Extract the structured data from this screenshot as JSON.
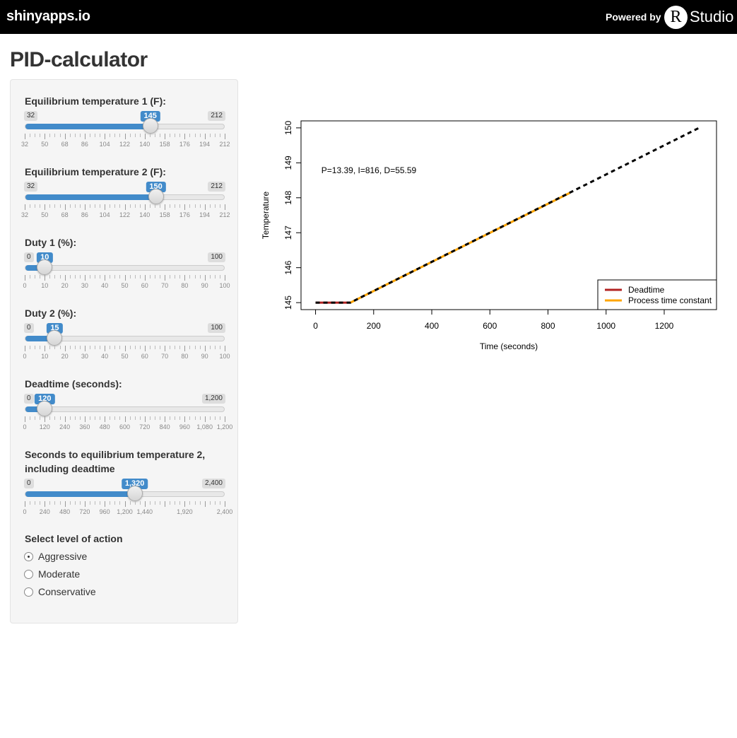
{
  "header": {
    "brand": "shinyapps.io",
    "powered_by": "Powered by",
    "rstudio_r": "R",
    "rstudio_text": "Studio"
  },
  "page": {
    "title": "PID-calculator"
  },
  "controls": {
    "sliders": [
      {
        "id": "temp1",
        "label": "Equilibrium temperature 1 (F):",
        "min": 32,
        "max": 212,
        "value": 145,
        "min_label": "32",
        "max_label": "212",
        "value_label": "145",
        "tick_labels": [
          "32",
          "50",
          "68",
          "86",
          "104",
          "122",
          "140",
          "158",
          "176",
          "194",
          "212"
        ]
      },
      {
        "id": "temp2",
        "label": "Equilibrium temperature 2 (F):",
        "min": 32,
        "max": 212,
        "value": 150,
        "min_label": "32",
        "max_label": "212",
        "value_label": "150",
        "tick_labels": [
          "32",
          "50",
          "68",
          "86",
          "104",
          "122",
          "140",
          "158",
          "176",
          "194",
          "212"
        ]
      },
      {
        "id": "duty1",
        "label": "Duty 1 (%):",
        "min": 0,
        "max": 100,
        "value": 10,
        "min_label": "0",
        "max_label": "100",
        "value_label": "10",
        "tick_labels": [
          "0",
          "10",
          "20",
          "30",
          "40",
          "50",
          "60",
          "70",
          "80",
          "90",
          "100"
        ]
      },
      {
        "id": "duty2",
        "label": "Duty 2 (%):",
        "min": 0,
        "max": 100,
        "value": 15,
        "min_label": "0",
        "max_label": "100",
        "value_label": "15",
        "tick_labels": [
          "0",
          "10",
          "20",
          "30",
          "40",
          "50",
          "60",
          "70",
          "80",
          "90",
          "100"
        ]
      },
      {
        "id": "deadtime",
        "label": "Deadtime (seconds):",
        "min": 0,
        "max": 1200,
        "value": 120,
        "min_label": "0",
        "max_label": "1,200",
        "value_label": "120",
        "tick_labels": [
          "0",
          "120",
          "240",
          "360",
          "480",
          "600",
          "720",
          "840",
          "960",
          "1,080",
          "1,200"
        ]
      },
      {
        "id": "seconds",
        "label": "Seconds to equilibrium temperature 2, including deadtime",
        "min": 0,
        "max": 2400,
        "value": 1320,
        "min_label": "0",
        "max_label": "2,400",
        "value_label": "1,320",
        "tick_labels": [
          "0",
          "240",
          "480",
          "720",
          "960",
          "1,200",
          "1,440",
          "",
          "1,920",
          "",
          "2,400"
        ]
      }
    ],
    "radio": {
      "label": "Select level of action",
      "options": [
        "Aggressive",
        "Moderate",
        "Conservative"
      ],
      "selected": "Aggressive"
    }
  },
  "chart_data": {
    "type": "line",
    "title": "",
    "xlabel": "Time (seconds)",
    "ylabel": "Temperature",
    "xlim": [
      -50,
      1380
    ],
    "ylim": [
      144.8,
      150.2
    ],
    "x_ticks": [
      0,
      200,
      400,
      600,
      800,
      1000,
      1200
    ],
    "y_ticks": [
      145,
      146,
      147,
      148,
      149,
      150
    ],
    "annotation": "P=13.39, I=816, D=55.59",
    "legend_position": "bottom-right",
    "series": [
      {
        "name": "Deadtime",
        "color": "#b22222",
        "style": "solid",
        "x": [
          0,
          120
        ],
        "y": [
          145,
          145
        ]
      },
      {
        "name": "Process time constant",
        "color": "#ffa500",
        "style": "solid",
        "x": [
          120,
          875
        ],
        "y": [
          145,
          148.14
        ]
      },
      {
        "name": "",
        "color": "#000000",
        "style": "dashed",
        "x": [
          0,
          120,
          1320
        ],
        "y": [
          145,
          145,
          150
        ]
      }
    ]
  }
}
